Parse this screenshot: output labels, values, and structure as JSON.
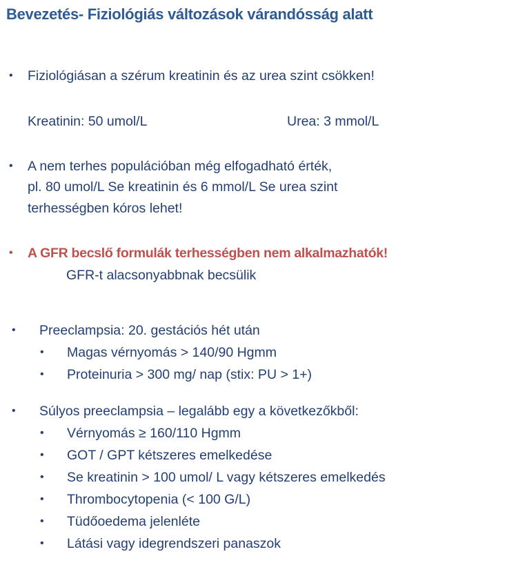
{
  "title": "Bevezetés- Fiziológiás változások várandósság alatt",
  "bullet_icon": "bullet-dot",
  "colors": {
    "title": "#2e5b94",
    "body": "#243f72",
    "highlight": "#c0504d"
  },
  "section1": {
    "text": "Fiziológiásan a szérum kreatinin és az urea szint csökken!",
    "kreatinin": "Kreatinin: 50 umol/L",
    "urea": "Urea: 3 mmol/L"
  },
  "section2": {
    "lines": [
      "A nem terhes populációban még elfogadható érték,",
      "pl. 80 umol/L Se kreatinin és 6 mmol/L Se urea szint",
      "terhességben kóros lehet!"
    ]
  },
  "section3": {
    "text": "A GFR becslő formulák terhességben nem alkalmazhatók!",
    "sub": "GFR-t alacsonyabbnak becsülik"
  },
  "section4": {
    "text": "Preeclampsia: 20. gestációs hét után",
    "items": [
      "Magas vérnyomás > 140/90 Hgmm",
      "Proteinuria > 300 mg/ nap (stix: PU > 1+)"
    ]
  },
  "section5": {
    "text": "Súlyos preeclampsia – legalább egy a következőkből:",
    "items": [
      "Vérnyomás ≥ 160/110 Hgmm",
      "GOT / GPT kétszeres emelkedése",
      "Se kreatinin > 100 umol/ L vagy kétszeres emelkedés",
      "Thrombocytopenia (< 100 G/L)",
      "Tüdőoedema jelenléte",
      "Látási vagy idegrendszeri panaszok"
    ]
  }
}
